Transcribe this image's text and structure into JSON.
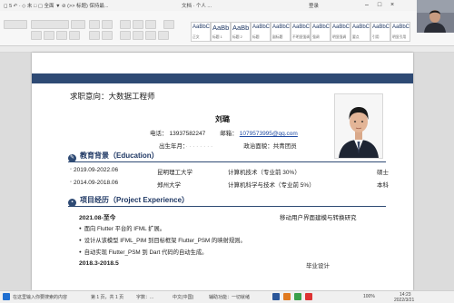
{
  "titlebar": {
    "left_text": "◻ 5 ↶ · ◇ 未 □ ▢ 全面 ▼ ⊘ (>> 标题) 保持最...",
    "center_text": "文档 · 个人 ...",
    "right_text": "登录"
  },
  "ribbon": {
    "styles": [
      {
        "preview": "AaBbC",
        "name": "正文"
      },
      {
        "preview": "AaBb",
        "name": "标题 1",
        "big": true
      },
      {
        "preview": "AaBb",
        "name": "标题 2",
        "big": true
      },
      {
        "preview": "AaBbC",
        "name": "标题"
      },
      {
        "preview": "AaBbC",
        "name": "副标题"
      },
      {
        "preview": "AaBbCcD",
        "name": "不明显强调"
      },
      {
        "preview": "AaBbCcD",
        "name": "强调"
      },
      {
        "preview": "AaBbCcD",
        "name": "明显强调"
      },
      {
        "preview": "AaBbCc",
        "name": "要点"
      },
      {
        "preview": "AaBbCcD",
        "name": "引用"
      },
      {
        "preview": "AaBbCcD",
        "name": "明显引用"
      }
    ]
  },
  "resume": {
    "objective": "求职意向：大数据工程师",
    "name": "刘璐",
    "phone_label": "电话：",
    "phone": "13937582247",
    "email_label": "邮箱：",
    "email": "1079573995@qq.com",
    "birth_label": "出生年月：",
    "politics_label": "政治面貌：",
    "politics": "共青团员",
    "education": {
      "heading": "教育背景（Education）",
      "rows": [
        {
          "period": "2019.09-2022.06",
          "school": "昆明理工大学",
          "major": "计算机技术（专业前 30%）",
          "degree": "硕士"
        },
        {
          "period": "2014.09-2018.06",
          "school": "郑州大学",
          "major": "计算机科学与技术（专业前 5%）",
          "degree": "本科"
        }
      ]
    },
    "projects": {
      "heading": "项目经历（Project Experience）",
      "p1_period": "2021.08-至今",
      "p1_title": "移动用户界面建模与转换研究",
      "bullets": [
        "面向 Flutter 平台的 IFML 扩展。",
        "设计从该模型 IFML_PIM 到目标框架 Flutter_PSM 的映射规则。",
        "自动实现 Flutter_PSM 到 Dart 代码的自动生成。"
      ],
      "p2_period": "2018.3-2018.5",
      "p2_title": "毕业设计"
    }
  },
  "status": {
    "page": "第 1 页，共 1 页",
    "words": "字数：...",
    "lang": "中文(中国)",
    "focus": "辅助功能：一切就绪",
    "search": "在这里输入你要搜索的内容",
    "zoom": "100%",
    "time": "14:23",
    "date": "2022/3/21"
  }
}
